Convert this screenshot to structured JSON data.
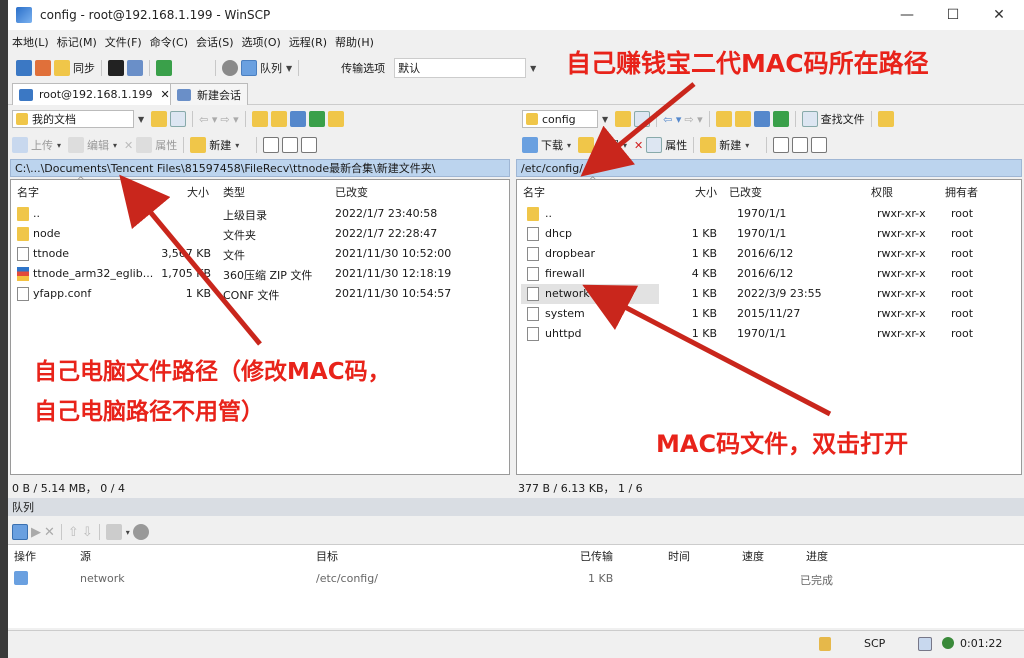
{
  "window": {
    "title": "config - root@192.168.1.199 - WinSCP",
    "controls": {
      "minimize": "—",
      "maximize": "☐",
      "close": "✕"
    }
  },
  "menu": [
    "本地(L)",
    "标记(M)",
    "文件(F)",
    "命令(C)",
    "会话(S)",
    "选项(O)",
    "远程(R)",
    "帮助(H)"
  ],
  "toolbar": {
    "sync_label": "同步",
    "queue_label": "队列",
    "transfer_label": "传输选项",
    "transfer_value": "默认"
  },
  "tabs": [
    {
      "label": "root@192.168.1.199",
      "close": "✕"
    },
    {
      "label": "新建会话"
    }
  ],
  "left_panel": {
    "location": "我的文档",
    "upload_label": "上传",
    "edit_label": "编辑",
    "properties_label": "属性",
    "new_label": "新建",
    "path": "C:\\...\\Documents\\Tencent Files\\81597458\\FileRecv\\ttnode最新合集\\新建文件夹\\",
    "columns": {
      "name": "名字",
      "size": "大小",
      "type": "类型",
      "modified": "已改变"
    },
    "files": [
      {
        "name": "..",
        "size": "",
        "type": "上级目录",
        "modified": "2022/1/7  23:40:58",
        "icon": "folder-up"
      },
      {
        "name": "node",
        "size": "",
        "type": "文件夹",
        "modified": "2022/1/7  22:28:47",
        "icon": "folder"
      },
      {
        "name": "ttnode",
        "size": "3,567 KB",
        "type": "文件",
        "modified": "2021/11/30  10:52:00",
        "icon": "file"
      },
      {
        "name": "ttnode_arm32_eglib...",
        "size": "1,705 KB",
        "type": "360压缩 ZIP 文件",
        "modified": "2021/11/30  12:18:19",
        "icon": "zip"
      },
      {
        "name": "yfapp.conf",
        "size": "1 KB",
        "type": "CONF 文件",
        "modified": "2021/11/30  10:54:57",
        "icon": "file"
      }
    ],
    "status": "0 B / 5.14 MB，  0 / 4"
  },
  "right_panel": {
    "location": "config",
    "download_label": "下载",
    "edit_label": "编辑",
    "properties_label": "属性",
    "new_label": "新建",
    "find_label": "查找文件",
    "path": "/etc/config/",
    "columns": {
      "name": "名字",
      "size": "大小",
      "modified": "已改变",
      "rights": "权限",
      "owner": "拥有者"
    },
    "files": [
      {
        "name": "..",
        "size": "",
        "modified": "1970/1/1",
        "rights": "rwxr-xr-x",
        "owner": "root",
        "icon": "folder-up"
      },
      {
        "name": "dhcp",
        "size": "1 KB",
        "modified": "1970/1/1",
        "rights": "rwxr-xr-x",
        "owner": "root",
        "icon": "file"
      },
      {
        "name": "dropbear",
        "size": "1 KB",
        "modified": "2016/6/12",
        "rights": "rwxr-xr-x",
        "owner": "root",
        "icon": "file"
      },
      {
        "name": "firewall",
        "size": "4 KB",
        "modified": "2016/6/12",
        "rights": "rwxr-xr-x",
        "owner": "root",
        "icon": "file"
      },
      {
        "name": "network",
        "size": "1 KB",
        "modified": "2022/3/9 23:55",
        "rights": "rwxr-xr-x",
        "owner": "root",
        "icon": "file",
        "selected": true
      },
      {
        "name": "system",
        "size": "1 KB",
        "modified": "2015/11/27",
        "rights": "rwxr-xr-x",
        "owner": "root",
        "icon": "file"
      },
      {
        "name": "uhttpd",
        "size": "1 KB",
        "modified": "1970/1/1",
        "rights": "rwxr-xr-x",
        "owner": "root",
        "icon": "file"
      }
    ],
    "status": "377 B / 6.13 KB，  1 / 6"
  },
  "queue": {
    "title": "队列",
    "columns": {
      "operation": "操作",
      "source": "源",
      "target": "目标",
      "transferred": "已传输",
      "time": "时间",
      "speed": "速度",
      "progress": "进度"
    },
    "items": [
      {
        "source": "network",
        "target": "/etc/config/",
        "transferred": "1 KB",
        "time": "",
        "speed": "",
        "progress": "已完成"
      }
    ]
  },
  "statusbar": {
    "protocol": "SCP",
    "elapsed": "0:01:22"
  },
  "annotations": {
    "top_right": "自己赚钱宝二代MAC码所在路径",
    "left_line1": "自己电脑文件路径（修改MAC码，",
    "left_line2": "自己电脑路径不用管）",
    "right": "MAC码文件，双击打开"
  }
}
